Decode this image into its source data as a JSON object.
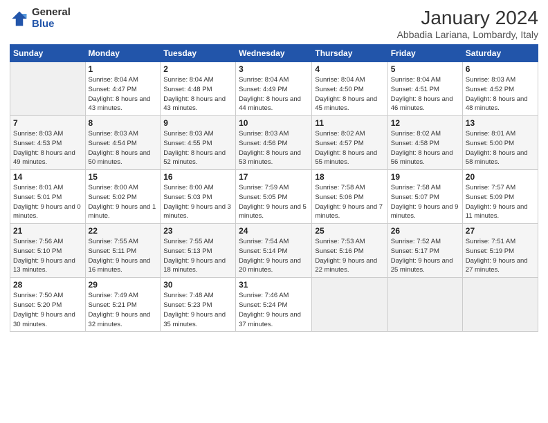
{
  "logo": {
    "general": "General",
    "blue": "Blue"
  },
  "title": "January 2024",
  "subtitle": "Abbadia Lariana, Lombardy, Italy",
  "headers": [
    "Sunday",
    "Monday",
    "Tuesday",
    "Wednesday",
    "Thursday",
    "Friday",
    "Saturday"
  ],
  "weeks": [
    [
      {
        "day": "",
        "info": ""
      },
      {
        "day": "1",
        "info": "Sunrise: 8:04 AM\nSunset: 4:47 PM\nDaylight: 8 hours\nand 43 minutes."
      },
      {
        "day": "2",
        "info": "Sunrise: 8:04 AM\nSunset: 4:48 PM\nDaylight: 8 hours\nand 43 minutes."
      },
      {
        "day": "3",
        "info": "Sunrise: 8:04 AM\nSunset: 4:49 PM\nDaylight: 8 hours\nand 44 minutes."
      },
      {
        "day": "4",
        "info": "Sunrise: 8:04 AM\nSunset: 4:50 PM\nDaylight: 8 hours\nand 45 minutes."
      },
      {
        "day": "5",
        "info": "Sunrise: 8:04 AM\nSunset: 4:51 PM\nDaylight: 8 hours\nand 46 minutes."
      },
      {
        "day": "6",
        "info": "Sunrise: 8:03 AM\nSunset: 4:52 PM\nDaylight: 8 hours\nand 48 minutes."
      }
    ],
    [
      {
        "day": "7",
        "info": "Sunrise: 8:03 AM\nSunset: 4:53 PM\nDaylight: 8 hours\nand 49 minutes."
      },
      {
        "day": "8",
        "info": "Sunrise: 8:03 AM\nSunset: 4:54 PM\nDaylight: 8 hours\nand 50 minutes."
      },
      {
        "day": "9",
        "info": "Sunrise: 8:03 AM\nSunset: 4:55 PM\nDaylight: 8 hours\nand 52 minutes."
      },
      {
        "day": "10",
        "info": "Sunrise: 8:03 AM\nSunset: 4:56 PM\nDaylight: 8 hours\nand 53 minutes."
      },
      {
        "day": "11",
        "info": "Sunrise: 8:02 AM\nSunset: 4:57 PM\nDaylight: 8 hours\nand 55 minutes."
      },
      {
        "day": "12",
        "info": "Sunrise: 8:02 AM\nSunset: 4:58 PM\nDaylight: 8 hours\nand 56 minutes."
      },
      {
        "day": "13",
        "info": "Sunrise: 8:01 AM\nSunset: 5:00 PM\nDaylight: 8 hours\nand 58 minutes."
      }
    ],
    [
      {
        "day": "14",
        "info": "Sunrise: 8:01 AM\nSunset: 5:01 PM\nDaylight: 9 hours\nand 0 minutes."
      },
      {
        "day": "15",
        "info": "Sunrise: 8:00 AM\nSunset: 5:02 PM\nDaylight: 9 hours\nand 1 minute."
      },
      {
        "day": "16",
        "info": "Sunrise: 8:00 AM\nSunset: 5:03 PM\nDaylight: 9 hours\nand 3 minutes."
      },
      {
        "day": "17",
        "info": "Sunrise: 7:59 AM\nSunset: 5:05 PM\nDaylight: 9 hours\nand 5 minutes."
      },
      {
        "day": "18",
        "info": "Sunrise: 7:58 AM\nSunset: 5:06 PM\nDaylight: 9 hours\nand 7 minutes."
      },
      {
        "day": "19",
        "info": "Sunrise: 7:58 AM\nSunset: 5:07 PM\nDaylight: 9 hours\nand 9 minutes."
      },
      {
        "day": "20",
        "info": "Sunrise: 7:57 AM\nSunset: 5:09 PM\nDaylight: 9 hours\nand 11 minutes."
      }
    ],
    [
      {
        "day": "21",
        "info": "Sunrise: 7:56 AM\nSunset: 5:10 PM\nDaylight: 9 hours\nand 13 minutes."
      },
      {
        "day": "22",
        "info": "Sunrise: 7:55 AM\nSunset: 5:11 PM\nDaylight: 9 hours\nand 16 minutes."
      },
      {
        "day": "23",
        "info": "Sunrise: 7:55 AM\nSunset: 5:13 PM\nDaylight: 9 hours\nand 18 minutes."
      },
      {
        "day": "24",
        "info": "Sunrise: 7:54 AM\nSunset: 5:14 PM\nDaylight: 9 hours\nand 20 minutes."
      },
      {
        "day": "25",
        "info": "Sunrise: 7:53 AM\nSunset: 5:16 PM\nDaylight: 9 hours\nand 22 minutes."
      },
      {
        "day": "26",
        "info": "Sunrise: 7:52 AM\nSunset: 5:17 PM\nDaylight: 9 hours\nand 25 minutes."
      },
      {
        "day": "27",
        "info": "Sunrise: 7:51 AM\nSunset: 5:19 PM\nDaylight: 9 hours\nand 27 minutes."
      }
    ],
    [
      {
        "day": "28",
        "info": "Sunrise: 7:50 AM\nSunset: 5:20 PM\nDaylight: 9 hours\nand 30 minutes."
      },
      {
        "day": "29",
        "info": "Sunrise: 7:49 AM\nSunset: 5:21 PM\nDaylight: 9 hours\nand 32 minutes."
      },
      {
        "day": "30",
        "info": "Sunrise: 7:48 AM\nSunset: 5:23 PM\nDaylight: 9 hours\nand 35 minutes."
      },
      {
        "day": "31",
        "info": "Sunrise: 7:46 AM\nSunset: 5:24 PM\nDaylight: 9 hours\nand 37 minutes."
      },
      {
        "day": "",
        "info": ""
      },
      {
        "day": "",
        "info": ""
      },
      {
        "day": "",
        "info": ""
      }
    ]
  ]
}
